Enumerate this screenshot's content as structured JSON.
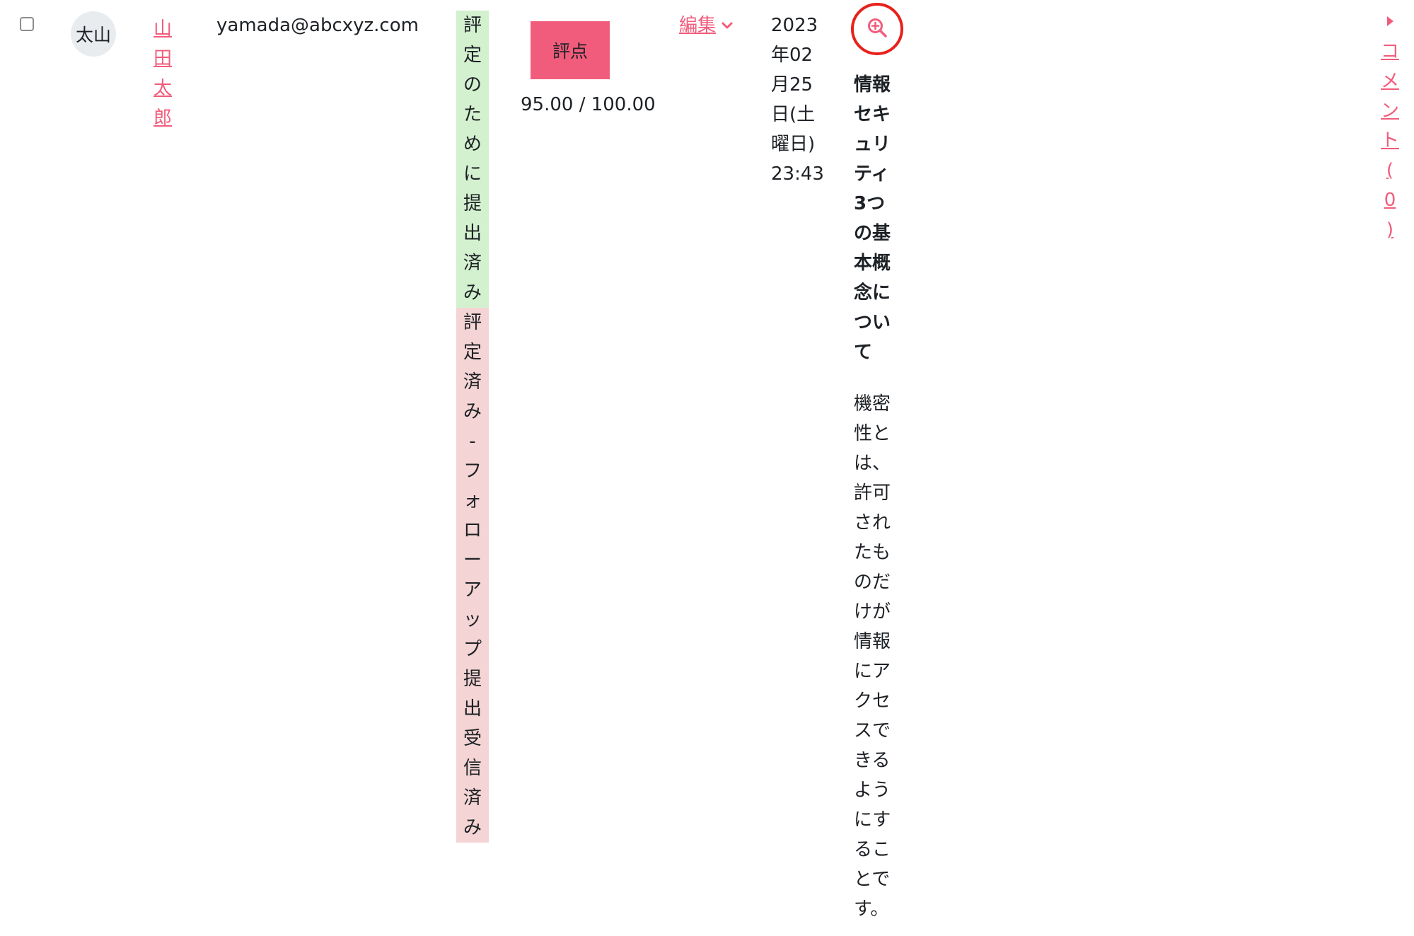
{
  "row": {
    "avatar_initials": "太山",
    "name": "山田太郎",
    "email": "yamada@abcxyz.com",
    "status_submitted": "評定のために提出済み",
    "status_graded": "評定済み - フォローアップ提出受信済み",
    "grade_button_label": "評点",
    "grade_value": "95.00 / 100.00",
    "edit_menu_label": "編集",
    "last_modified": "2023年02月25日(土曜日) 23:43",
    "submission_title": "情報セキュリティ3つの基本概念について",
    "submission_text": "機密性とは、許可されたものだけが情報にアクセスできるようにすることです。",
    "comments_label": "コメント (0)"
  },
  "colors": {
    "link": "#f25c7c",
    "grade_button_bg": "#f25c7c",
    "status_submitted_bg": "#d3f0cf",
    "status_graded_bg": "#f4d4d4",
    "highlight_ring": "#e8201b",
    "avatar_bg": "#e9ecef"
  },
  "icons": {
    "zoom": "zoom-in-icon",
    "edit_menu": "chevron-down-icon",
    "comments": "caret-right-icon"
  }
}
